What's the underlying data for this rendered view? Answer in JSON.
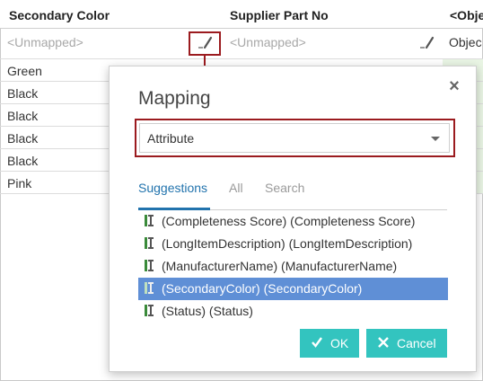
{
  "grid": {
    "headers": [
      "Secondary Color",
      "Supplier Part No",
      "<Obje"
    ],
    "unmapped_1": "<Unmapped>",
    "unmapped_2": "<Unmapped>",
    "obj_cell": "Objec",
    "rows": [
      "Green",
      "Black",
      "Black",
      "Black",
      "Black",
      "Pink"
    ]
  },
  "dialog": {
    "title": "Mapping",
    "close_label": "×",
    "select_value": "Attribute",
    "tabs": [
      "Suggestions",
      "All",
      "Search"
    ],
    "active_tab": "Suggestions",
    "suggestions": [
      "(Completeness Score) (Completeness Score)",
      "(LongItemDescription) (LongItemDescription)",
      "(ManufacturerName) (ManufacturerName)",
      "(SecondaryColor) (SecondaryColor)",
      "(Status) (Status)"
    ],
    "selected_suggestion": "(SecondaryColor) (SecondaryColor)",
    "ok_label": "OK",
    "cancel_label": "Cancel"
  },
  "colors": {
    "accent_blue": "#2173ad",
    "selection_blue": "#5f8fd6",
    "button_teal": "#33c4bf",
    "highlight_red": "#9b1b1f",
    "mapped_green": "#e9f5e4"
  },
  "icons": {
    "edit": "pencil-icon",
    "attribute": "attribute-icon",
    "close": "close-icon",
    "ok": "checkmark-icon",
    "cancel": "x-icon"
  }
}
